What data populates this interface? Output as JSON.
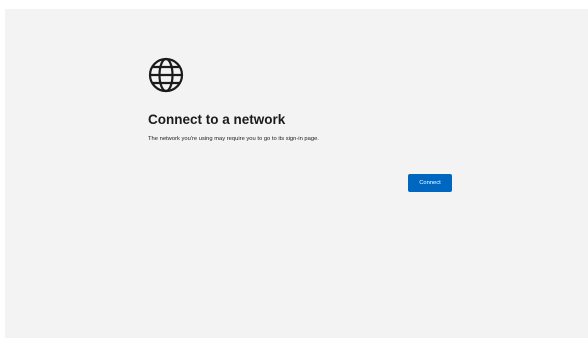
{
  "content": {
    "icon": "globe-icon",
    "title": "Connect to a network",
    "description": "The network you're using may require you to go to its sign-in page."
  },
  "actions": {
    "connect_label": "Connect"
  },
  "colors": {
    "background": "#f3f3f3",
    "accent": "#0067c0",
    "text": "#1b1b1b"
  }
}
